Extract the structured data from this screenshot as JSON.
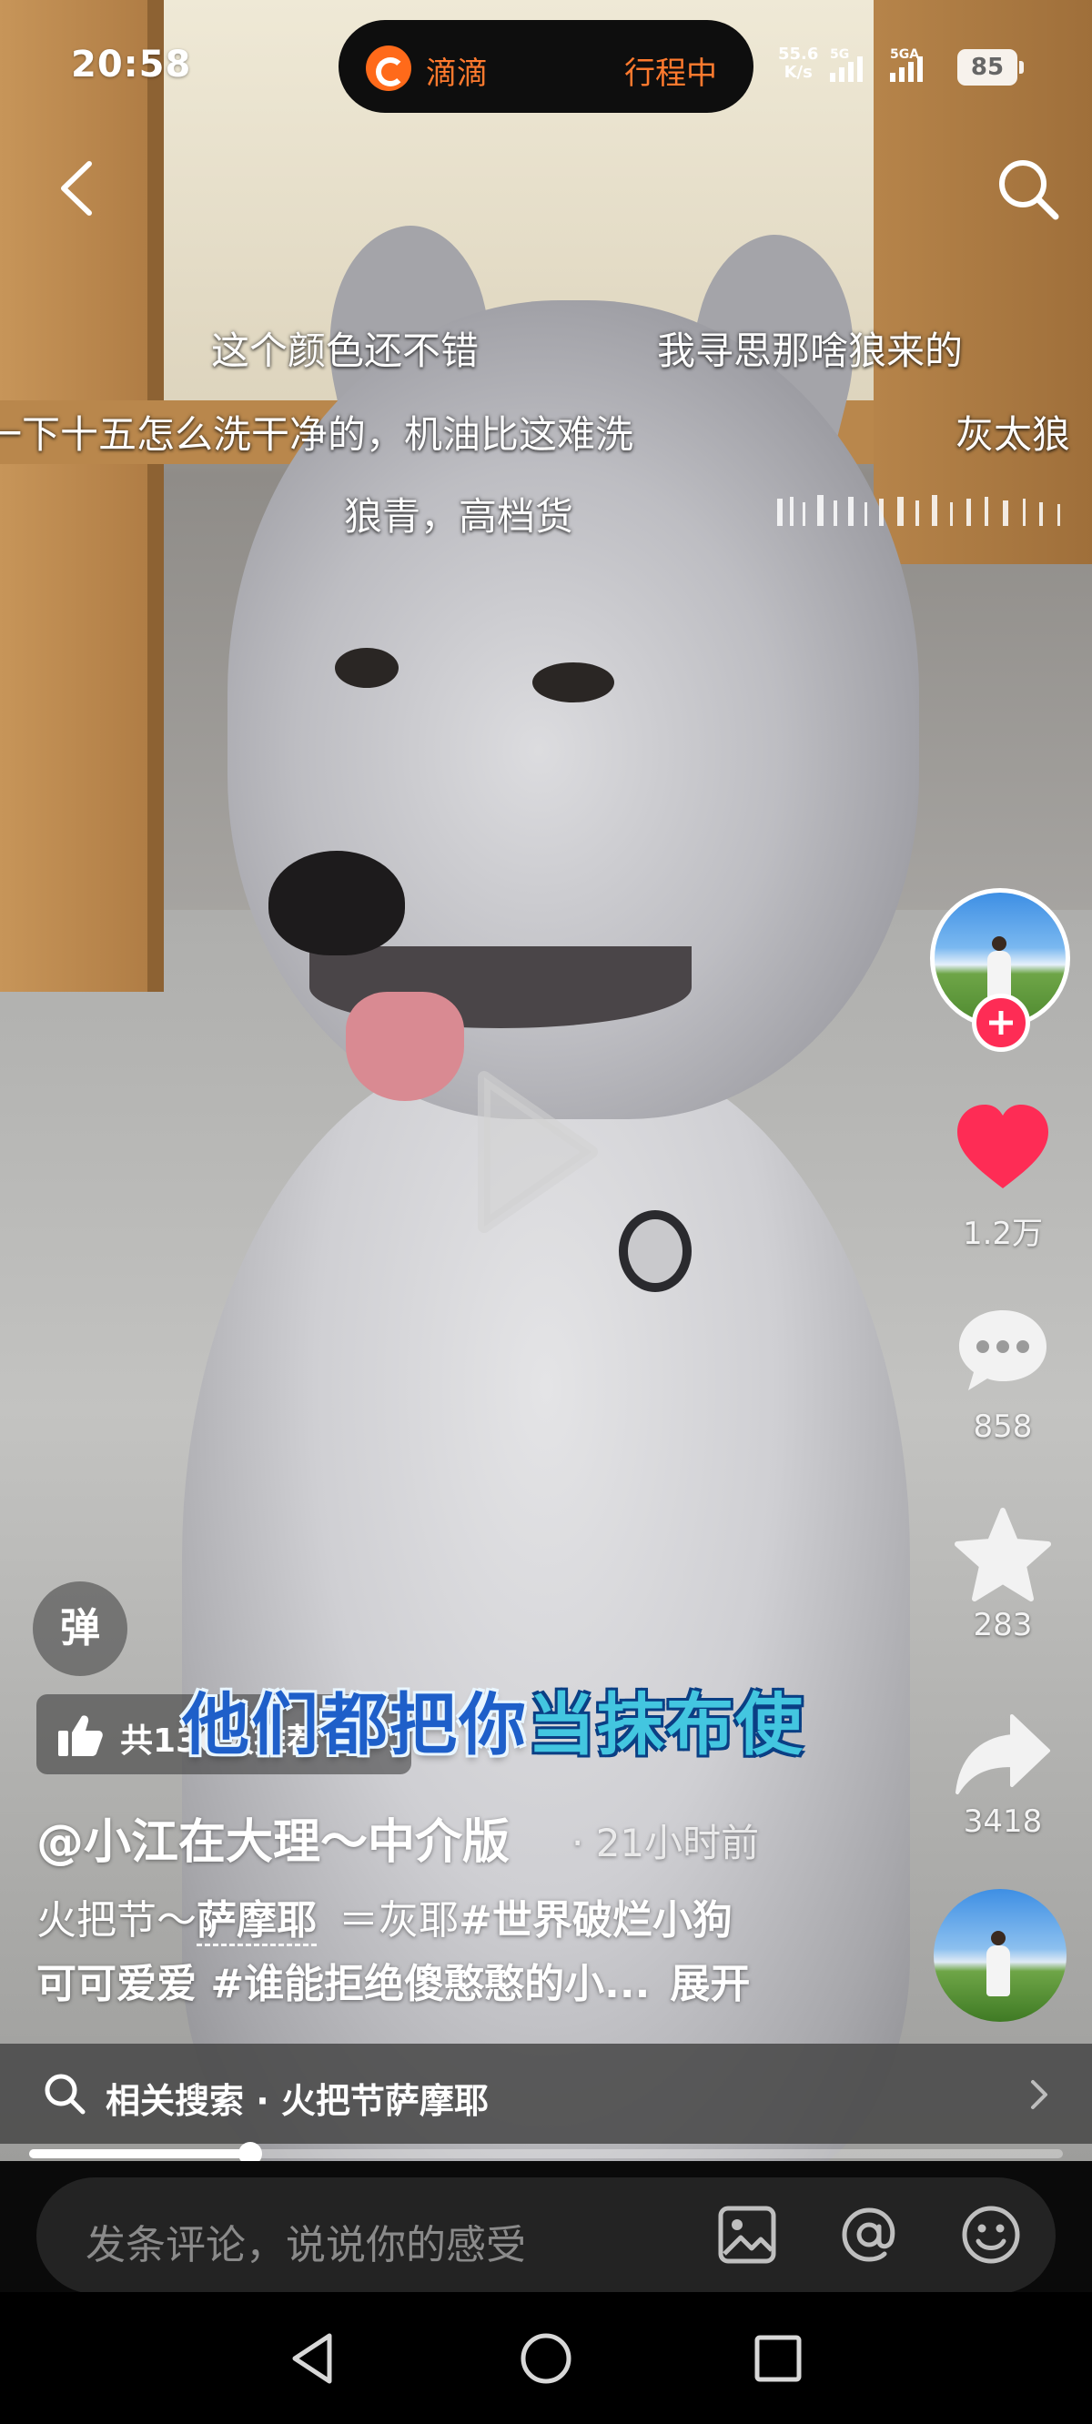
{
  "status_bar": {
    "time": "20:58",
    "didi_app": "滴滴",
    "didi_status": "行程中",
    "net_speed_value": "55.6",
    "net_speed_unit": "K/s",
    "signal_1": "5G",
    "signal_2": "5GA",
    "battery": "85"
  },
  "nav": {
    "back_icon": "back-chevron",
    "search_icon": "magnifier"
  },
  "danmaku": [
    "这个颜色还不错",
    "我寻思那啥狼来的",
    "一下十五怎么洗干净的，机油比这难洗",
    "灰太狼",
    "狼青，高档货"
  ],
  "video": {
    "caption_part1": "他们都把你",
    "caption_part2": "当抹布使",
    "play_icon": "play-triangle"
  },
  "rail": {
    "follow_icon": "plus",
    "likes": "1.2万",
    "comments": "858",
    "favorites": "283",
    "shares": "3418",
    "like_color": "#fe2c55"
  },
  "danmaku_toggle": "弹",
  "recommend": {
    "text": "共136人推荐"
  },
  "author": {
    "name": "@小江在大理～中介版",
    "time": "· 21小时前"
  },
  "description": {
    "line1_prefix": "火把节～",
    "line1_tag": "萨摩耶",
    "line1_mid": "＝灰耶",
    "line1_hashtag": "#世界破烂小狗",
    "line2_text": "可可爱爱 #谁能拒绝傻憨憨的小...",
    "expand": "展开"
  },
  "related_search": {
    "text": "相关搜索 · 火把节萨摩耶"
  },
  "progress": {
    "fraction": 0.214
  },
  "comment_bar": {
    "placeholder": "发条评论，说说你的感受",
    "icons": [
      "image-icon",
      "at-icon",
      "emoji-icon"
    ]
  },
  "system_nav": {
    "icons": [
      "back-triangle",
      "home-circle",
      "recents-square"
    ]
  }
}
